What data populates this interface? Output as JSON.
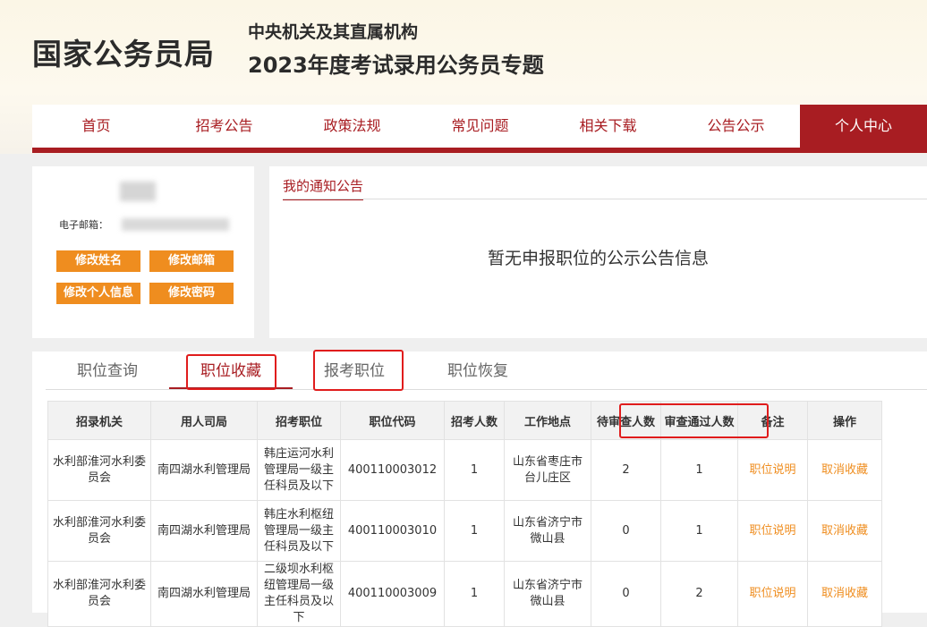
{
  "header": {
    "brand": "国家公务员局",
    "subtitle_line1": "中央机关及其直属机构",
    "subtitle_line2": "2023年度考试录用公务员专题"
  },
  "nav": {
    "items": [
      {
        "label": "首页"
      },
      {
        "label": "招考公告"
      },
      {
        "label": "政策法规"
      },
      {
        "label": "常见问题"
      },
      {
        "label": "相关下载"
      },
      {
        "label": "公告公示"
      },
      {
        "label": "个人中心",
        "active": true
      }
    ]
  },
  "profile": {
    "email_label": "电子邮箱：",
    "buttons": {
      "edit_name": "修改姓名",
      "edit_email": "修改邮箱",
      "edit_info": "修改个人信息",
      "edit_password": "修改密码"
    }
  },
  "notice": {
    "tab_label": "我的通知公告",
    "empty_text": "暂无申报职位的公示公告信息"
  },
  "tabs": [
    {
      "label": "职位查询"
    },
    {
      "label": "职位收藏",
      "active": true
    },
    {
      "label": "报考职位"
    },
    {
      "label": "职位恢复"
    }
  ],
  "table": {
    "headers": [
      "招录机关",
      "用人司局",
      "招考职位",
      "职位代码",
      "招考人数",
      "工作地点",
      "待审查人数",
      "审查通过人数",
      "备注",
      "操作"
    ],
    "rows": [
      {
        "agency": "水利部淮河水利委员会",
        "bureau": "南四湖水利管理局",
        "position": "韩庄运河水利管理局一级主任科员及以下",
        "code": "400110003012",
        "count": "1",
        "location": "山东省枣庄市台儿庄区",
        "pending": "2",
        "approved": "1",
        "note": "职位说明",
        "action": "取消收藏"
      },
      {
        "agency": "水利部淮河水利委员会",
        "bureau": "南四湖水利管理局",
        "position": "韩庄水利枢纽管理局一级主任科员及以下",
        "code": "400110003010",
        "count": "1",
        "location": "山东省济宁市微山县",
        "pending": "0",
        "approved": "1",
        "note": "职位说明",
        "action": "取消收藏"
      },
      {
        "agency": "水利部淮河水利委员会",
        "bureau": "南四湖水利管理局",
        "position": "二级坝水利枢纽管理局一级主任科员及以下",
        "code": "400110003009",
        "count": "1",
        "location": "山东省济宁市微山县",
        "pending": "0",
        "approved": "2",
        "note": "职位说明",
        "action": "取消收藏"
      }
    ]
  },
  "colors": {
    "brand_red": "#a81d22",
    "orange": "#ef8d1f",
    "highlight_red": "#e01c1c"
  }
}
